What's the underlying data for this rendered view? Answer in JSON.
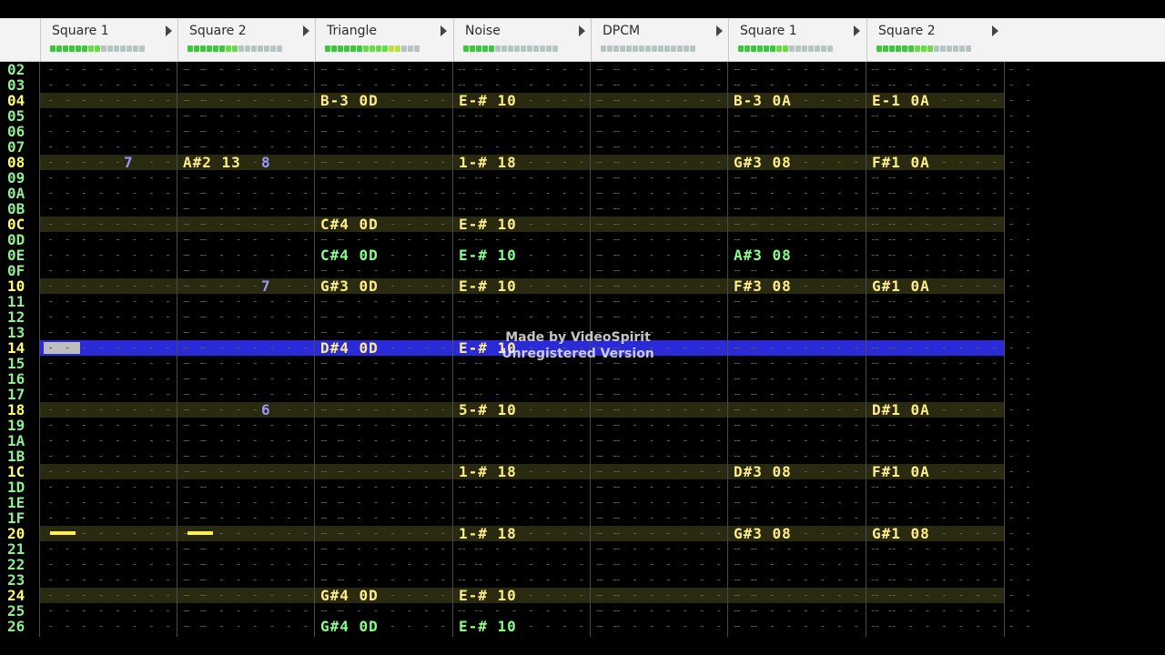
{
  "channels": [
    {
      "name": "Square 1",
      "vu_on": 8
    },
    {
      "name": "Square 2",
      "vu_on": 8
    },
    {
      "name": "Triangle",
      "vu_on": 12
    },
    {
      "name": "Noise",
      "vu_on": 5
    },
    {
      "name": "DPCM",
      "vu_on": 0
    },
    {
      "name": "Square 1",
      "vu_on": 8
    },
    {
      "name": "Square 2",
      "vu_on": 9
    }
  ],
  "colors": {
    "row_highlight": "#ffff66",
    "row_normal": "#90ee90",
    "note_yellow": "#ffee88",
    "note_green": "#88ff88",
    "volume_blue": "#9999ff",
    "cursor": "#2a2ad8"
  },
  "rows": [
    "02",
    "03",
    "04",
    "05",
    "06",
    "07",
    "08",
    "09",
    "0A",
    "0B",
    "0C",
    "0D",
    "0E",
    "0F",
    "10",
    "11",
    "12",
    "13",
    "14",
    "15",
    "16",
    "17",
    "18",
    "19",
    "1A",
    "1B",
    "1C",
    "1D",
    "1E",
    "1F",
    "20",
    "21",
    "22",
    "23",
    "24",
    "25",
    "26"
  ],
  "highlight_rows": [
    "04",
    "08",
    "0C",
    "10",
    "14",
    "18",
    "1C",
    "20",
    "24"
  ],
  "current_row": "14",
  "notes": [
    {
      "row": "04",
      "ch": 2,
      "text": "B-3 0D",
      "color": "yellow"
    },
    {
      "row": "04",
      "ch": 3,
      "text": "E-# 10",
      "color": "yellow"
    },
    {
      "row": "04",
      "ch": 5,
      "text": "B-3 0A",
      "color": "yellow"
    },
    {
      "row": "04",
      "ch": 6,
      "text": "E-1 0A",
      "color": "yellow"
    },
    {
      "row": "08",
      "ch": 0,
      "text": "7",
      "color": "blue",
      "offset": 86
    },
    {
      "row": "08",
      "ch": 1,
      "text": "A#2 13",
      "color": "yellow"
    },
    {
      "row": "08",
      "ch": 1,
      "text": "8",
      "color": "blue",
      "offset": 86
    },
    {
      "row": "08",
      "ch": 3,
      "text": "1-# 18",
      "color": "yellow"
    },
    {
      "row": "08",
      "ch": 5,
      "text": "G#3 08",
      "color": "yellow"
    },
    {
      "row": "08",
      "ch": 6,
      "text": "F#1 0A",
      "color": "yellow"
    },
    {
      "row": "0C",
      "ch": 2,
      "text": "C#4 0D",
      "color": "yellow"
    },
    {
      "row": "0C",
      "ch": 3,
      "text": "E-# 10",
      "color": "yellow"
    },
    {
      "row": "0E",
      "ch": 2,
      "text": "C#4 0D",
      "color": "green"
    },
    {
      "row": "0E",
      "ch": 3,
      "text": "E-# 10",
      "color": "green"
    },
    {
      "row": "0E",
      "ch": 5,
      "text": "A#3 08",
      "color": "green"
    },
    {
      "row": "10",
      "ch": 1,
      "text": "7",
      "color": "blue",
      "offset": 86
    },
    {
      "row": "10",
      "ch": 2,
      "text": "G#3 0D",
      "color": "yellow"
    },
    {
      "row": "10",
      "ch": 3,
      "text": "E-# 10",
      "color": "yellow"
    },
    {
      "row": "10",
      "ch": 5,
      "text": "F#3 08",
      "color": "yellow"
    },
    {
      "row": "10",
      "ch": 6,
      "text": "G#1 0A",
      "color": "yellow"
    },
    {
      "row": "14",
      "ch": 2,
      "text": "D#4 0D",
      "color": "yellow"
    },
    {
      "row": "14",
      "ch": 3,
      "text": "E-# 10",
      "color": "yellow"
    },
    {
      "row": "18",
      "ch": 1,
      "text": "6",
      "color": "blue",
      "offset": 86
    },
    {
      "row": "18",
      "ch": 3,
      "text": "5-# 10",
      "color": "yellow"
    },
    {
      "row": "18",
      "ch": 6,
      "text": "D#1 0A",
      "color": "yellow"
    },
    {
      "row": "1C",
      "ch": 3,
      "text": "1-# 18",
      "color": "yellow"
    },
    {
      "row": "1C",
      "ch": 5,
      "text": "D#3 08",
      "color": "yellow"
    },
    {
      "row": "1C",
      "ch": 6,
      "text": "F#1 0A",
      "color": "yellow"
    },
    {
      "row": "20",
      "ch": 3,
      "text": "1-# 18",
      "color": "yellow"
    },
    {
      "row": "20",
      "ch": 5,
      "text": "G#3 08",
      "color": "yellow"
    },
    {
      "row": "20",
      "ch": 6,
      "text": "G#1 08",
      "color": "yellow"
    },
    {
      "row": "24",
      "ch": 2,
      "text": "G#4 0D",
      "color": "yellow"
    },
    {
      "row": "24",
      "ch": 3,
      "text": "E-# 10",
      "color": "yellow"
    },
    {
      "row": "26",
      "ch": 2,
      "text": "G#4 0D",
      "color": "green"
    },
    {
      "row": "26",
      "ch": 3,
      "text": "E-# 10",
      "color": "green"
    }
  ],
  "note_off_markers": [
    {
      "row": "20",
      "ch": 0
    },
    {
      "row": "20",
      "ch": 1
    }
  ],
  "watermark": {
    "line1": "Made by VideoSpirit",
    "line2": "Unregistered Version"
  }
}
